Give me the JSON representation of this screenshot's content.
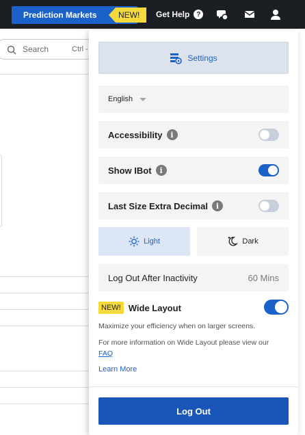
{
  "topbar": {
    "prediction_markets": "Prediction Markets",
    "new_badge": "NEW!",
    "get_help": "Get Help",
    "help_glyph": "?",
    "icons": [
      "chat-icon",
      "mail-icon",
      "user-icon"
    ]
  },
  "search": {
    "placeholder": "Search",
    "shortcut": "Ctrl -"
  },
  "panel": {
    "settings_label": "Settings",
    "language": "English",
    "rows": [
      {
        "label": "Accessibility",
        "enabled": false
      },
      {
        "label": "Show IBot",
        "enabled": true
      },
      {
        "label": "Last Size Extra Decimal",
        "enabled": false
      }
    ],
    "info_glyph": "i",
    "theme": {
      "light": "Light",
      "dark": "Dark",
      "selected": "Light"
    },
    "logout_after": {
      "label": "Log Out After Inactivity",
      "value": "60 Mins"
    },
    "wide_layout": {
      "badge": "NEW!",
      "title": "Wide Layout",
      "enabled": true,
      "desc1": "Maximize your efficiency when on larger screens.",
      "desc2_prefix": "For more information on Wide Layout please view our",
      "faq": "FAQ",
      "learn_more": "Learn More"
    },
    "logout_button": "Log Out"
  },
  "colors": {
    "accent": "#1a62c9",
    "topbar": "#1b1e23",
    "badge": "#f6d93b"
  }
}
